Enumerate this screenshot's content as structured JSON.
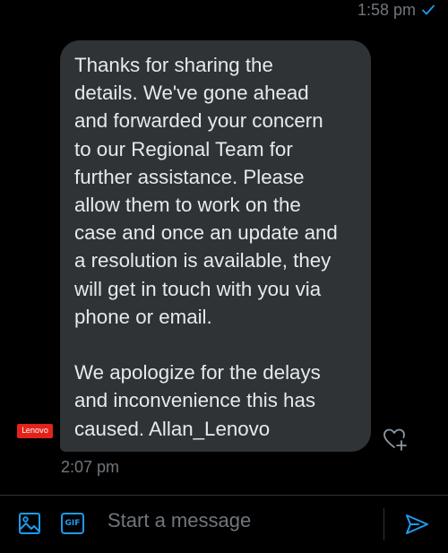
{
  "previous_message": {
    "time": "1:58 pm",
    "status_icon": "check-icon"
  },
  "message": {
    "sender_logo_text": "Lenovo",
    "text": "Thanks for sharing the\ndetails. We've gone ahead\nand forwarded your concern\nto our Regional Team for\nfurther assistance. Please\nallow them to work on the\ncase and once an update and\na resolution is available, they\nwill get in touch with you via\nphone or email.\n\nWe apologize for the delays\nand inconvenience this has\ncaused. Allan_Lenovo",
    "time": "2:07 pm",
    "reaction_icon": "add-reaction-icon"
  },
  "composer": {
    "placeholder": "Start a message",
    "media_icon": "image-icon",
    "gif_label": "GIF",
    "send_icon": "send-icon"
  },
  "colors": {
    "background": "#000000",
    "bubble": "#2f3336",
    "accent": "#1d9bf0",
    "secondary_text": "#71767b",
    "brand_red": "#e2231a"
  }
}
